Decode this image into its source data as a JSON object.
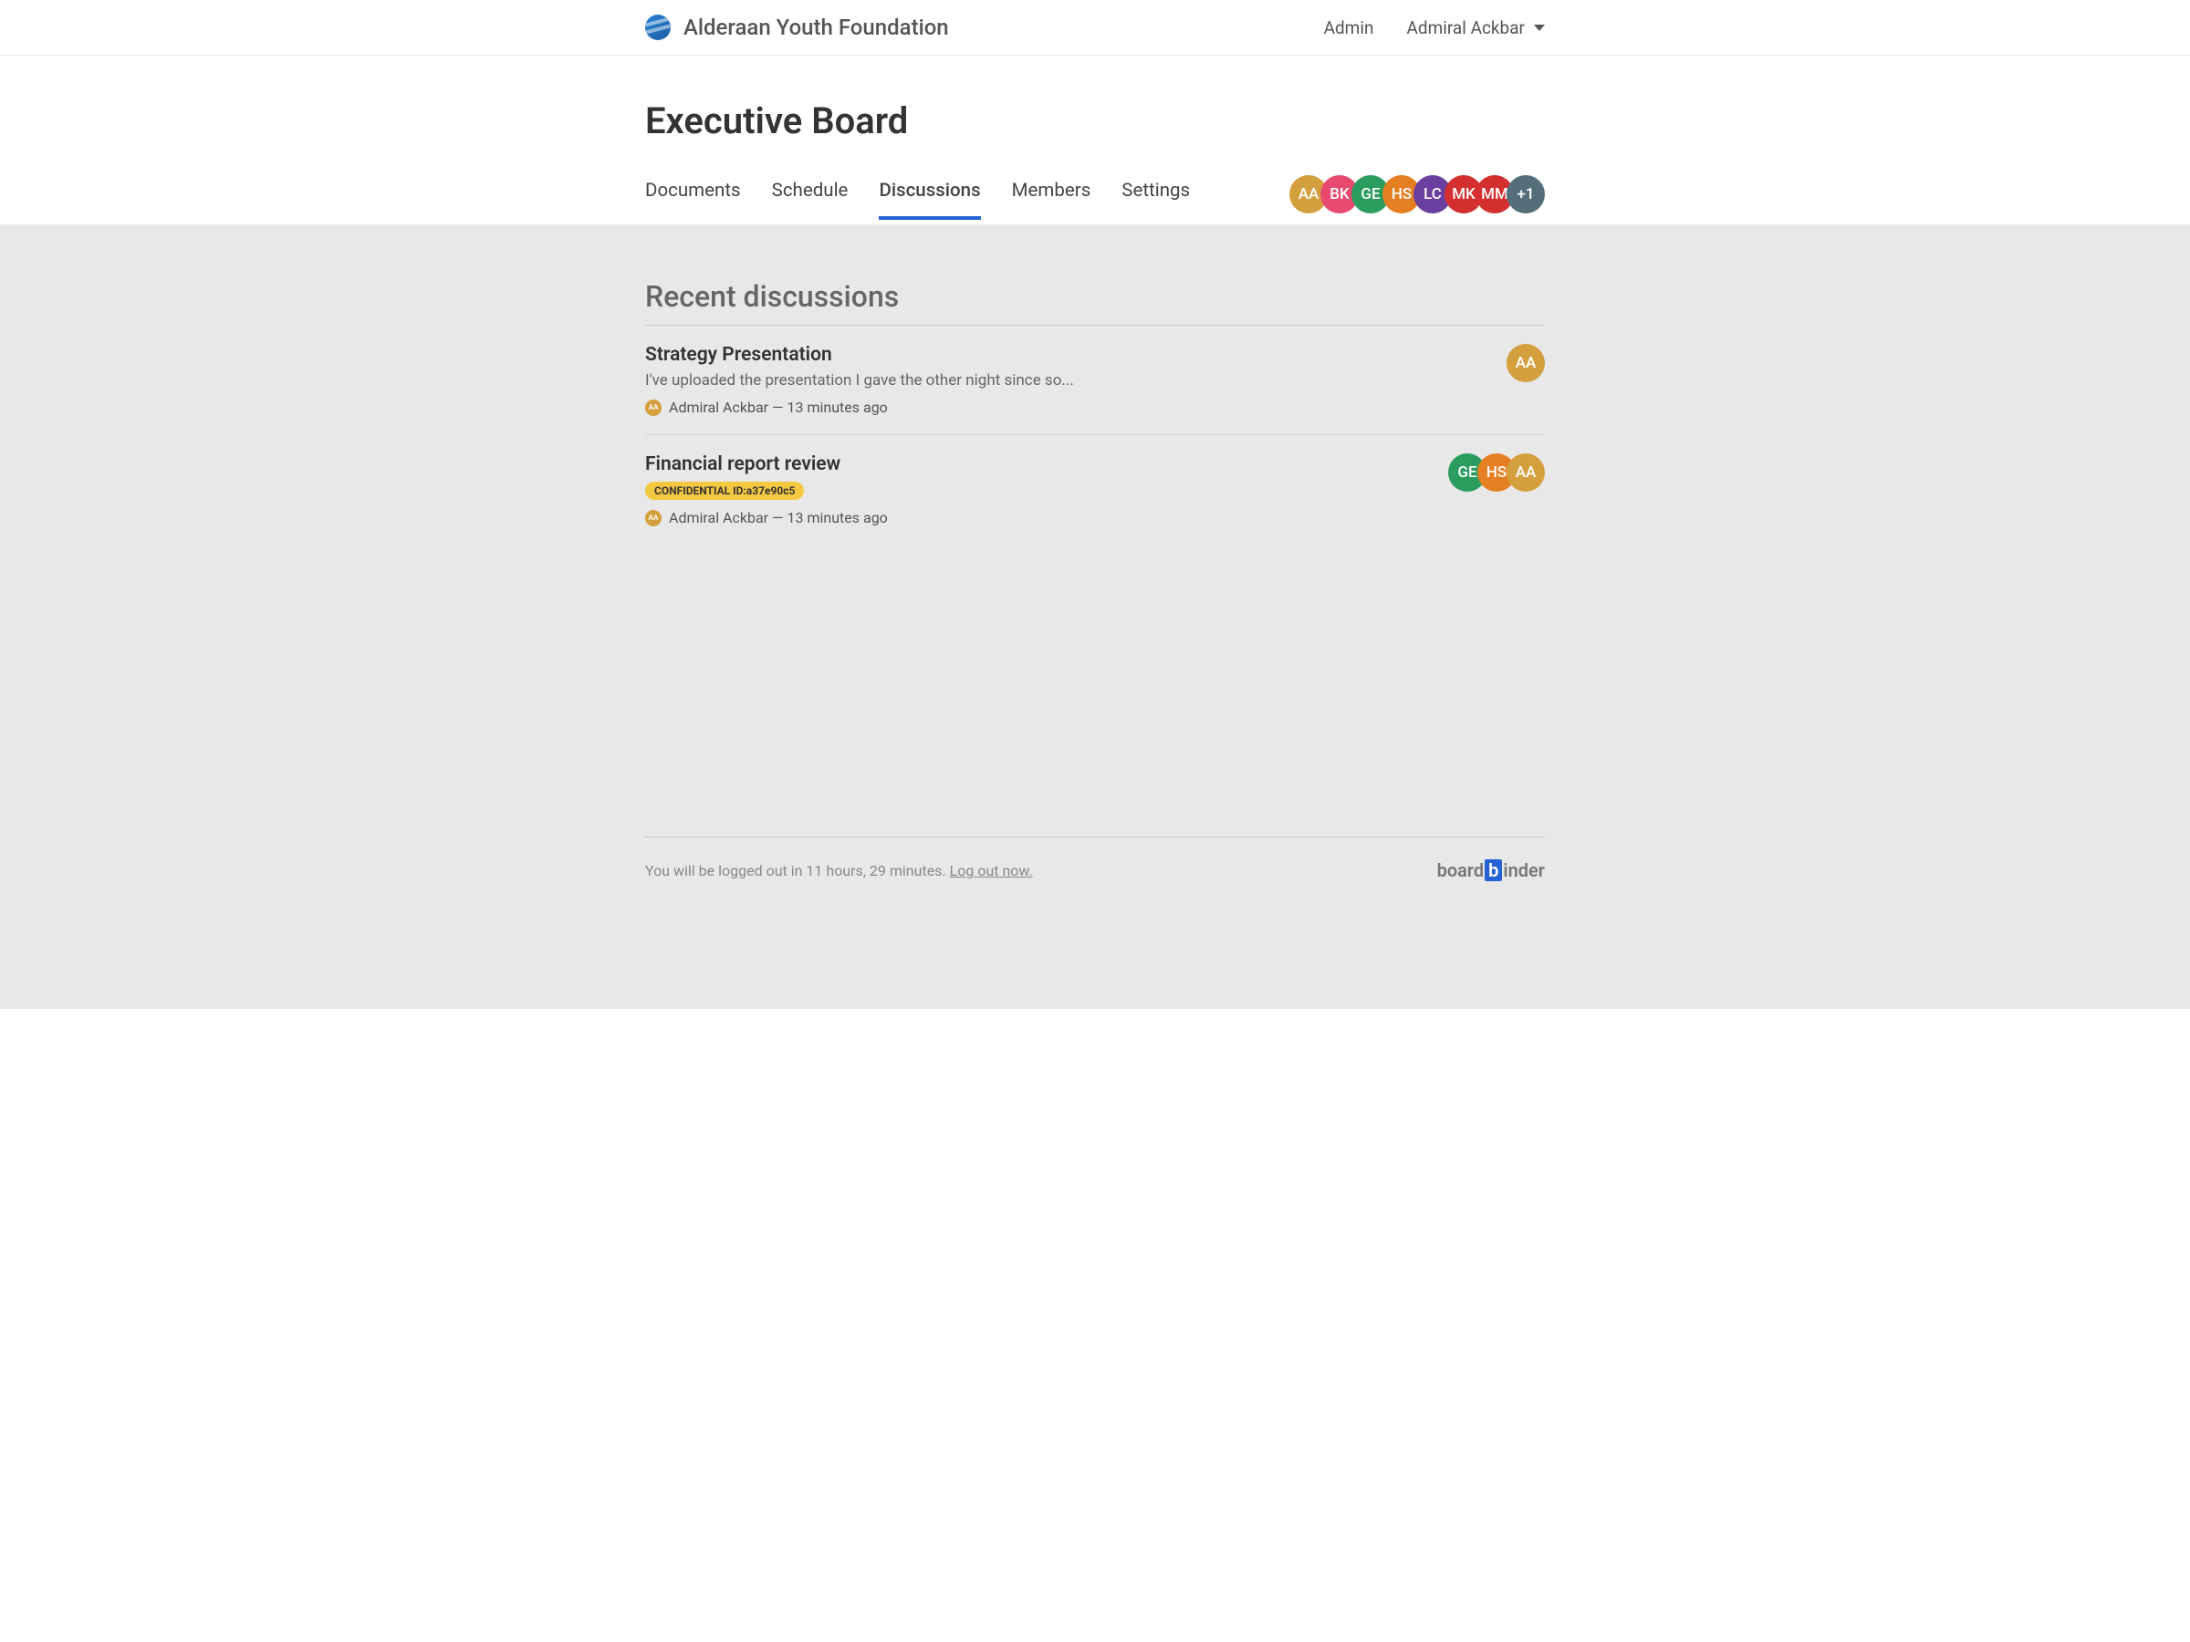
{
  "header": {
    "org_name": "Alderaan Youth Foundation",
    "admin_link": "Admin",
    "user_name": "Admiral Ackbar"
  },
  "board": {
    "title": "Executive Board"
  },
  "tabs": [
    {
      "label": "Documents",
      "active": false
    },
    {
      "label": "Schedule",
      "active": false
    },
    {
      "label": "Discussions",
      "active": true
    },
    {
      "label": "Members",
      "active": false
    },
    {
      "label": "Settings",
      "active": false
    }
  ],
  "member_avatars": [
    {
      "initials": "AA",
      "color": "#d4a03e"
    },
    {
      "initials": "BK",
      "color": "#e84a6f"
    },
    {
      "initials": "GE",
      "color": "#2a9d5e"
    },
    {
      "initials": "HS",
      "color": "#e67e22"
    },
    {
      "initials": "LC",
      "color": "#6b3fa0"
    },
    {
      "initials": "MK",
      "color": "#d32f2f"
    },
    {
      "initials": "MM",
      "color": "#d32f2f"
    },
    {
      "initials": "+1",
      "color": "#546e7a"
    }
  ],
  "section_title": "Recent discussions",
  "discussions": [
    {
      "title": "Strategy Presentation",
      "preview": "I've uploaded the presentation I gave the other night since so...",
      "author_initials": "AA",
      "author_color": "#d4a03e",
      "author_name": "Admiral Ackbar",
      "timestamp": "13 minutes ago",
      "badge": null,
      "participants": [
        {
          "initials": "AA",
          "color": "#d4a03e"
        }
      ]
    },
    {
      "title": "Financial report review",
      "preview": null,
      "author_initials": "AA",
      "author_color": "#d4a03e",
      "author_name": "Admiral Ackbar",
      "timestamp": "13 minutes ago",
      "badge": "CONFIDENTIAL ID:a37e90c5",
      "participants": [
        {
          "initials": "GE",
          "color": "#2a9d5e"
        },
        {
          "initials": "HS",
          "color": "#e67e22"
        },
        {
          "initials": "AA",
          "color": "#d4a03e"
        }
      ]
    }
  ],
  "footer": {
    "logout_text_prefix": "You will be logged out in 11 hours, 29 minutes. ",
    "logout_link": "Log out now.",
    "brand_part1": "board",
    "brand_b": "b",
    "brand_part2": "inder"
  }
}
